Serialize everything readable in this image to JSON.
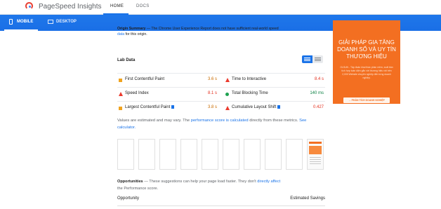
{
  "header": {
    "app_title": "PageSpeed Insights",
    "nav_home": "HOME",
    "nav_docs": "DOCS"
  },
  "modes": {
    "mobile": "MOBILE",
    "desktop": "DESKTOP"
  },
  "origin_summary": {
    "heading": "Origin Summary",
    "dash": "—",
    "text": "The Chrome User Experience Report does not have sufficient real-world speed",
    "link": "data",
    "tail": "for this origin."
  },
  "lab_data": {
    "title": "Lab Data",
    "metrics": [
      {
        "name": "First Contentful Paint",
        "value": "3.6 s",
        "indicator": "average"
      },
      {
        "name": "Time to Interactive",
        "value": "8.4 s",
        "indicator": "fail"
      },
      {
        "name": "Speed Index",
        "value": "8.1 s",
        "indicator": "fail"
      },
      {
        "name": "Total Blocking Time",
        "value": "140 ms",
        "indicator": "pass"
      },
      {
        "name": "Largest Contentful Paint",
        "value": "3.8 s",
        "indicator": "average"
      },
      {
        "name": "Cumulative Layout Shift",
        "value": "0.427",
        "indicator": "fail"
      }
    ],
    "note_prefix": "Values are estimated and may vary. The",
    "note_link1": "performance score is calculated",
    "note_mid": "directly from these metrics.",
    "note_link2": "See calculator."
  },
  "opportunities": {
    "title": "Opportunities",
    "dash": "—",
    "text": "These suggestions can help your page load faster. They don't",
    "link": "directly affect",
    "tail": "the Performance score.",
    "col_left": "Opportunity",
    "col_right": "Estimated Savings"
  },
  "ad": {
    "title": "GIẢI PHÁP GIA TĂNG DOANH SỐ VÀ UY TÍN THƯƠNG HIỆU",
    "body": "OLSUN - Tập đoàn khai thác phần mềm, xuất bản tích hợp toàn diện gắn với thương hiệu với trên 2,000 Website chuyên nghiệp đến từng doanh nghiệp.",
    "button": "→ PHÂN TÍCH DOANH NGHIỆP"
  },
  "colors": {
    "brand_blue": "#1a73e8",
    "fail_red": "#e3301f",
    "average_orange": "#f0a31f",
    "pass_green": "#1fa251",
    "ad_orange": "#f36f21"
  },
  "icons": {
    "logo": "pagespeed-gauge-icon",
    "mobile": "phone-icon",
    "desktop": "monitor-icon",
    "toggle_expand": "expand-view-icon",
    "toggle_list": "list-view-icon"
  }
}
